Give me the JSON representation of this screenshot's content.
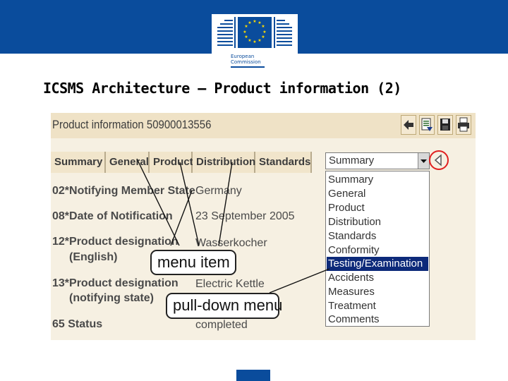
{
  "logo": {
    "line1": "European",
    "line2": "Commission",
    "colors": {
      "blue": "#0a4c9c",
      "star": "#ffdd00"
    }
  },
  "slide": {
    "title": "ICSMS Architecture – Product information (2)"
  },
  "app": {
    "header_title": "Product information 50900013556",
    "toolbar": {
      "back_icon": "back-arrow-icon",
      "export_icon": "export-icon",
      "save_icon": "save-icon",
      "print_icon": "print-icon"
    },
    "tabs": [
      {
        "label": "Summary"
      },
      {
        "label": "General"
      },
      {
        "label": "Product"
      },
      {
        "label": "Distribution"
      },
      {
        "label": "Standards"
      }
    ],
    "select": {
      "value": "Summary",
      "options": [
        "Summary",
        "General",
        "Product",
        "Distribution",
        "Standards",
        "Conformity",
        "Testing/Examination",
        "Accidents",
        "Measures",
        "Treatment",
        "Comments"
      ],
      "highlighted": "Testing/Examination"
    },
    "fields": [
      {
        "label": "02*Notifying Member State",
        "value": "Germany"
      },
      {
        "label": "08*Date of Notification",
        "value": "23 September 2005"
      },
      {
        "label_line1": "12*Product designation",
        "label_line2": "(English)",
        "value": "Wasserkocher"
      },
      {
        "label_line1": "13*Product designation",
        "label_line2": "(notifying state)",
        "value": "Electric Kettle"
      },
      {
        "label": "65  Status",
        "value": "completed"
      }
    ],
    "colors": {
      "highlight": "#0d2a7a",
      "circle": "#e02020",
      "header_bg": "#efe2c6",
      "panel_bg": "#f6f0e2"
    }
  },
  "callouts": {
    "menu_item": "menu item",
    "pulldown_menu": "pull-down menu"
  }
}
